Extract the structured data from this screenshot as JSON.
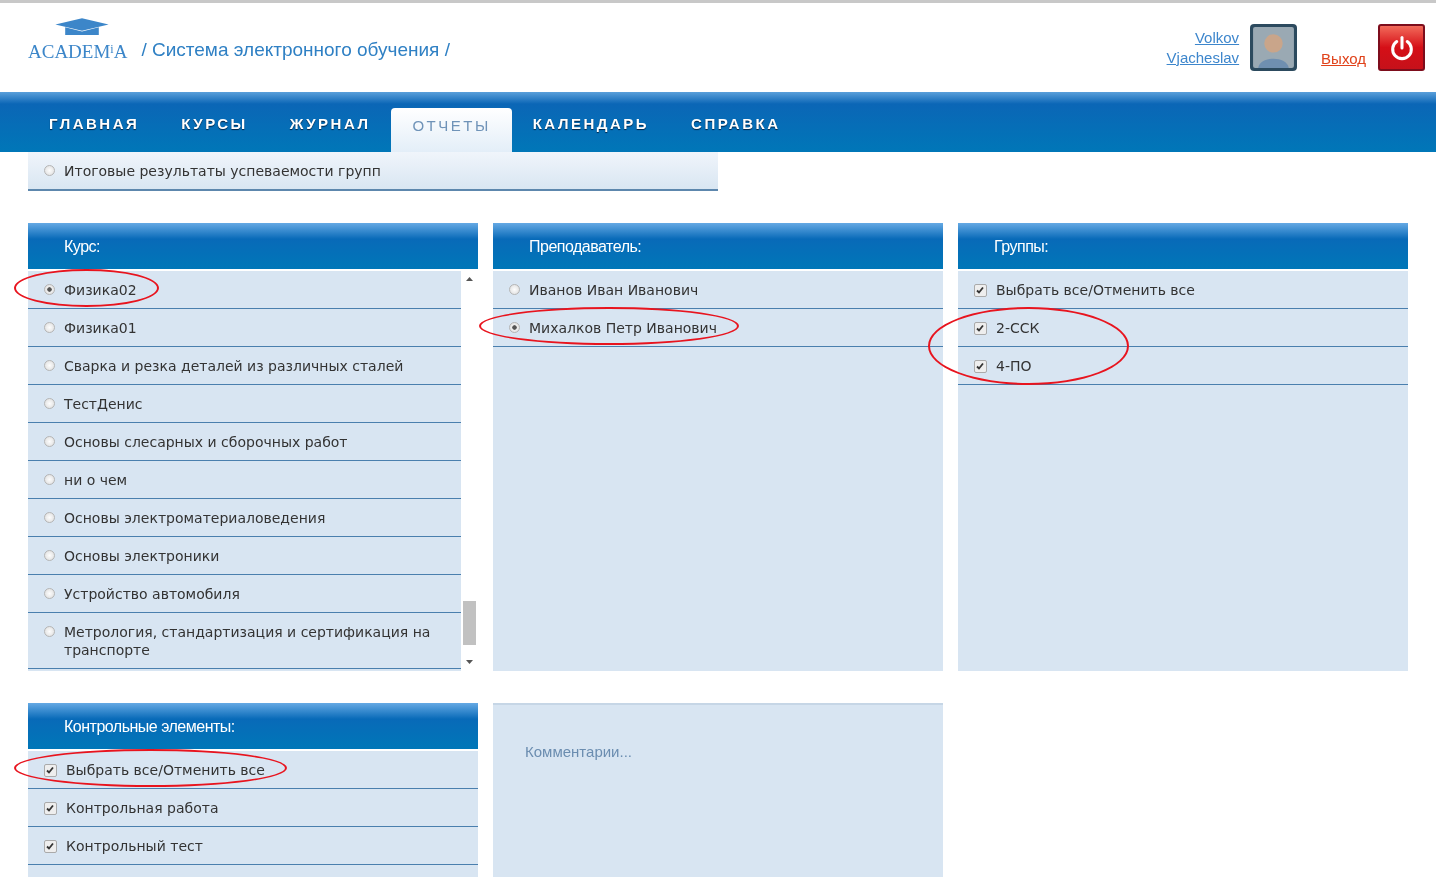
{
  "header": {
    "logo": "ACADEM$^{i}$A",
    "title": "/ Система электронного обучения /",
    "user_name": "Volkov Vjacheslav",
    "logout": "Выход"
  },
  "nav": [
    {
      "label": "ГЛАВНАЯ",
      "selected": false
    },
    {
      "label": "КУРСЫ",
      "selected": false
    },
    {
      "label": "ЖУРНАЛ",
      "selected": false
    },
    {
      "label": "ОТЧЕТЫ",
      "selected": true
    },
    {
      "label": "КАЛЕНДАРЬ",
      "selected": false
    },
    {
      "label": "СПРАВКА",
      "selected": false
    }
  ],
  "report_type": {
    "label": "Итоговые результаты успеваемости групп",
    "selected": false
  },
  "panels": [
    {
      "title": "Курс:",
      "kind": "radio",
      "scrollable": true,
      "items": [
        {
          "label": "Физика02",
          "selected": true,
          "circled": true
        },
        {
          "label": "Физика01",
          "selected": false,
          "circled": false
        },
        {
          "label": "Сварка и резка деталей из различных сталей",
          "selected": false,
          "circled": false
        },
        {
          "label": "ТестДенис",
          "selected": false,
          "circled": false
        },
        {
          "label": "Основы слесарных и сборочных работ",
          "selected": false,
          "circled": false
        },
        {
          "label": "ни о чем",
          "selected": false,
          "circled": false
        },
        {
          "label": "Основы электроматериаловедения",
          "selected": false,
          "circled": false
        },
        {
          "label": "Основы электроники",
          "selected": false,
          "circled": false
        },
        {
          "label": "Устройство автомобиля",
          "selected": false,
          "circled": false
        },
        {
          "label": "Метрология, стандартизация и сертификация на транспорте",
          "selected": false,
          "circled": false
        }
      ]
    },
    {
      "title": "Преподаватель:",
      "kind": "radio",
      "scrollable": false,
      "items": [
        {
          "label": "Иванов Иван Иванович",
          "selected": false,
          "circled": false
        },
        {
          "label": "Михалков Петр Иванович",
          "selected": true,
          "circled": true
        }
      ]
    },
    {
      "title": "Группы:",
      "kind": "checkbox",
      "scrollable": false,
      "items": [
        {
          "label": "Выбрать все/Отменить все",
          "checked": true,
          "circled": false
        },
        {
          "label": "2-ССК",
          "checked": true,
          "circled": true
        },
        {
          "label": "4-ПО",
          "checked": true,
          "circled": true
        }
      ]
    },
    {
      "title": "Контрольные элементы:",
      "kind": "checkbox",
      "scrollable": false,
      "items": [
        {
          "label": "Выбрать все/Отменить все",
          "checked": true,
          "circled": true
        },
        {
          "label": "Контрольная работа",
          "checked": true,
          "circled": false
        },
        {
          "label": "Контрольный тест",
          "checked": true,
          "circled": false
        }
      ]
    }
  ],
  "comments": {
    "placeholder": "Комментарии..."
  }
}
